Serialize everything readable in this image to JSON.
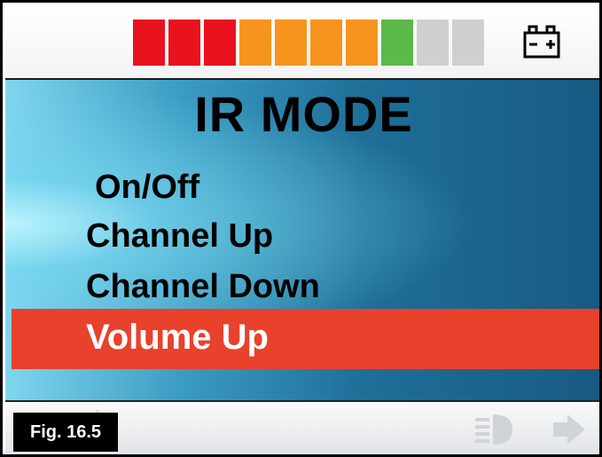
{
  "status_bar": {
    "battery_segments": [
      {
        "color": "#e8121e"
      },
      {
        "color": "#e8121e"
      },
      {
        "color": "#e8121e"
      },
      {
        "color": "#f7941d"
      },
      {
        "color": "#f7941d"
      },
      {
        "color": "#f7941d"
      },
      {
        "color": "#f7941d"
      },
      {
        "color": "#5ab947"
      },
      {
        "color": "#cfcfcf"
      },
      {
        "color": "#cfcfcf"
      }
    ],
    "battery_icon": "battery-icon"
  },
  "screen": {
    "title": "IR MODE",
    "menu_items": [
      {
        "label": "On/Off",
        "selected": false
      },
      {
        "label": "Channel Up",
        "selected": false
      },
      {
        "label": "Channel Down",
        "selected": false
      },
      {
        "label": "Volume Up",
        "selected": true
      }
    ],
    "highlight_color": "#e8412c"
  },
  "bottom_bar": {
    "icons": [
      "left-arrow-icon",
      "warning-icon",
      "headlight-icon",
      "right-arrow-icon"
    ]
  },
  "figure_label": "Fig. 16.5"
}
